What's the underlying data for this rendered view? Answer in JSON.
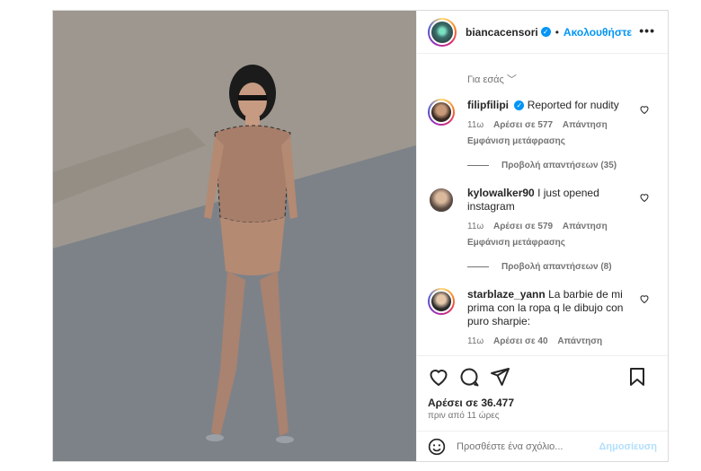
{
  "post": {
    "username": "biancacensori",
    "separator": "•",
    "follow_label": "Ακολουθήστε",
    "more_label": "•••"
  },
  "comments": {
    "for_you_label": "Για εσάς",
    "items": [
      {
        "user": "filipfilipi",
        "text": "Reported for nudity",
        "time": "11ω",
        "likes": "Αρέσει σε 577",
        "reply": "Απάντηση",
        "translate": "Εμφάνιση μετάφρασης",
        "view_replies": "Προβολή απαντήσεων (35)"
      },
      {
        "user": "kylowalker90",
        "text": "I just opened instagram",
        "time": "11ω",
        "likes": "Αρέσει σε 579",
        "reply": "Απάντηση",
        "translate": "Εμφάνιση μετάφρασης",
        "view_replies": "Προβολή απαντήσεων (8)"
      },
      {
        "user": "starblaze_yann",
        "text": "La barbie de mi prima con la ropa q le dibujo con puro sharpie:",
        "time": "11ω",
        "likes": "Αρέσει σε 40",
        "reply": "Απάντηση"
      }
    ]
  },
  "footer": {
    "likes_text": "Αρέσει σε 36.477",
    "time_ago": "πριν από 11 ώρες",
    "comment_placeholder": "Προσθέστε ένα σχόλιο...",
    "post_label": "Δημοσίευση"
  }
}
